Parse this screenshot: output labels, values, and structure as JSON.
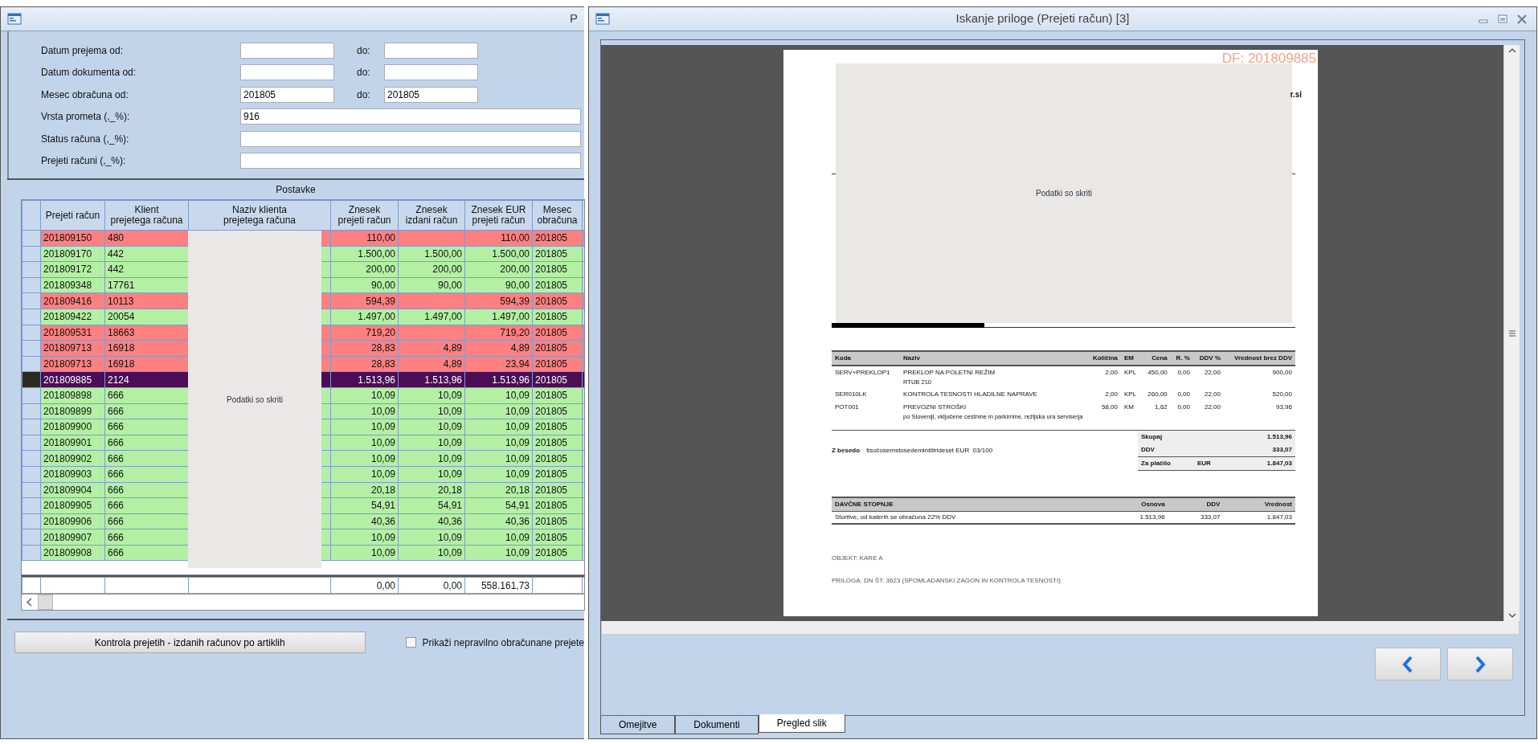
{
  "left_window": {
    "title": "P",
    "filters": [
      {
        "kind": "range",
        "label": "Datum prejema od:",
        "to_label": "do:"
      },
      {
        "kind": "range",
        "label": "Datum dokumenta od:",
        "to_label": "do:"
      },
      {
        "kind": "range",
        "label": "Mesec obračuna od:",
        "to_label": "do:",
        "value_from": "201805",
        "value_to": "201805"
      },
      {
        "kind": "single",
        "label": "Vrsta prometa (,_%):",
        "value": "916"
      },
      {
        "kind": "single",
        "label": "Status računa (,_%):"
      },
      {
        "kind": "single",
        "label": "Prejeti računi (,_%):"
      }
    ],
    "section_title": "Postavke",
    "table": {
      "columns": [
        "Prejeti račun",
        "Klient\nprejetega računa",
        "Naziv klienta\nprejetega računa",
        "Znesek\nprejeti račun",
        "Znesek\nizdani račun",
        "Znesek EUR\nprejeti račun",
        "Mesec\nobračuna"
      ],
      "rows": [
        {
          "cells": [
            "201809150",
            "480",
            null,
            "110,00",
            null,
            "110,00",
            "201805"
          ],
          "kind": "mismatch",
          "selected": false
        },
        {
          "cells": [
            "201809170",
            "442",
            null,
            "1.500,00",
            "1.500,00",
            "1.500,00",
            "201805"
          ],
          "kind": "match",
          "selected": false
        },
        {
          "cells": [
            "201809172",
            "442",
            null,
            "200,00",
            "200,00",
            "200,00",
            "201805"
          ],
          "kind": "match",
          "selected": false
        },
        {
          "cells": [
            "201809348",
            "17761",
            null,
            "90,00",
            "90,00",
            "90,00",
            "201805"
          ],
          "kind": "match",
          "selected": false
        },
        {
          "cells": [
            "201809416",
            "10113",
            null,
            "594,39",
            null,
            "594,39",
            "201805"
          ],
          "kind": "mismatch",
          "selected": false
        },
        {
          "cells": [
            "201809422",
            "20054",
            null,
            "1.497,00",
            "1.497,00",
            "1.497,00",
            "201805"
          ],
          "kind": "match",
          "selected": false
        },
        {
          "cells": [
            "201809531",
            "18663",
            null,
            "719,20",
            null,
            "719,20",
            "201805"
          ],
          "kind": "mismatch",
          "selected": false
        },
        {
          "cells": [
            "201809713",
            "16918",
            null,
            "28,83",
            "4,89",
            "4,89",
            "201805"
          ],
          "kind": "mismatch",
          "selected": false
        },
        {
          "cells": [
            "201809713",
            "16918",
            null,
            "28,83",
            "4,89",
            "23,94",
            "201805"
          ],
          "kind": "mismatch",
          "selected": false
        },
        {
          "cells": [
            "201809885",
            "2124",
            null,
            "1.513,96",
            "1.513,96",
            "1.513,96",
            "201805"
          ],
          "selected": true
        },
        {
          "cells": [
            "201809898",
            "666",
            null,
            "10,09",
            "10,09",
            "10,09",
            "201805"
          ],
          "kind": "match",
          "selected": false
        },
        {
          "cells": [
            "201809899",
            "666",
            null,
            "10,09",
            "10,09",
            "10,09",
            "201805"
          ],
          "kind": "match",
          "selected": false
        },
        {
          "cells": [
            "201809900",
            "666",
            null,
            "10,09",
            "10,09",
            "10,09",
            "201805"
          ],
          "kind": "match",
          "selected": false
        },
        {
          "cells": [
            "201809901",
            "666",
            null,
            "10,09",
            "10,09",
            "10,09",
            "201805"
          ],
          "kind": "match",
          "selected": false
        },
        {
          "cells": [
            "201809902",
            "666",
            null,
            "10,09",
            "10,09",
            "10,09",
            "201805"
          ],
          "kind": "match",
          "selected": false
        },
        {
          "cells": [
            "201809903",
            "666",
            null,
            "10,09",
            "10,09",
            "10,09",
            "201805"
          ],
          "kind": "match",
          "selected": false
        },
        {
          "cells": [
            "201809904",
            "666",
            null,
            "20,18",
            "20,18",
            "20,18",
            "201805"
          ],
          "kind": "match",
          "selected": false
        },
        {
          "cells": [
            "201809905",
            "666",
            null,
            "54,91",
            "54,91",
            "54,91",
            "201805"
          ],
          "kind": "match",
          "selected": false
        },
        {
          "cells": [
            "201809906",
            "666",
            null,
            "40,36",
            "40,36",
            "40,36",
            "201805"
          ],
          "kind": "match",
          "selected": false
        },
        {
          "cells": [
            "201809907",
            "666",
            null,
            "10,09",
            "10,09",
            "10,09",
            "201805"
          ],
          "kind": "match",
          "selected": false
        },
        {
          "cells": [
            "201809908",
            "666",
            null,
            "10,09",
            "10,09",
            "10,09",
            "201805"
          ],
          "kind": "match",
          "selected": false
        }
      ],
      "totals": {
        "znesek_prejeti": "0,00",
        "znesek_izdani": "0,00",
        "znesek_eur": "558.161,73"
      },
      "redaction_label": "Podatki so skriti"
    },
    "button": "Kontrola prejetih - izdanih računov po artiklih",
    "checkbox": {
      "label": "Prikaži nepravilno obračunane prejete",
      "checked": false
    }
  },
  "right_window": {
    "title": "Iskanje priloge (Prejeti račun) [3]",
    "document": {
      "stamp": "DF: 201809885",
      "header_fragment": "r.si",
      "redaction_label": "Podatki so skriti",
      "items_table": {
        "columns": [
          "Koda",
          "Naziv",
          "Količina",
          "EM",
          "Cena",
          "R. %",
          "DDV %",
          "Vrednost brez DDV"
        ],
        "rows": [
          {
            "cells": [
              "SERV+PREKLOP1",
              "PREKLOP NA POLETNI REŽIM",
              "2,00",
              "KPL",
              "450,00",
              "0,00",
              "22,00",
              "900,00"
            ],
            "note": "RTUB 210"
          },
          {
            "cells": [
              "SER010LK",
              "KONTROLA TESNOSTI HLADILNE NAPRAVE",
              "2,00",
              "KPL",
              "260,00",
              "0,00",
              "22,00",
              "520,00"
            ]
          },
          {
            "cells": [
              "POT001",
              "PREVOZNI STROŠKI",
              "58,00",
              "KM",
              "1,62",
              "0,00",
              "22,00",
              "93,96"
            ],
            "note": "po Sloveniji, vključene cestnine in parkirnine, režijska ura serviserja"
          }
        ]
      },
      "words_label": "Z besedo",
      "words": "tisočosemstosedeminštirideset EUR  03/100",
      "totals": [
        {
          "label": "Skupaj",
          "value": "1.513,96"
        },
        {
          "label": "DDV",
          "value": "333,07"
        },
        {
          "label": "Za plačilo",
          "currency": "EUR",
          "value": "1.847,03"
        }
      ],
      "tax_table": {
        "columns": [
          "DAVČNE STOPNJE",
          "Osnova",
          "DDV",
          "Vrednost"
        ],
        "rows": [
          [
            "Storitve, od katerih se obračuna 22% DDV",
            "1.513,96",
            "333,07",
            "1.847,03"
          ]
        ]
      },
      "notes": [
        "OBJEKT: KARE A",
        "PRILOGA: DN ŠT. 3623 (SPOMLADANSKI ZAGON IN KONTROLA TESNOSTI)"
      ]
    },
    "tabs": [
      {
        "label": "Omejitve",
        "selected": false
      },
      {
        "label": "Dokumenti",
        "selected": false
      },
      {
        "label": "Pregled slik",
        "selected": true
      }
    ]
  }
}
